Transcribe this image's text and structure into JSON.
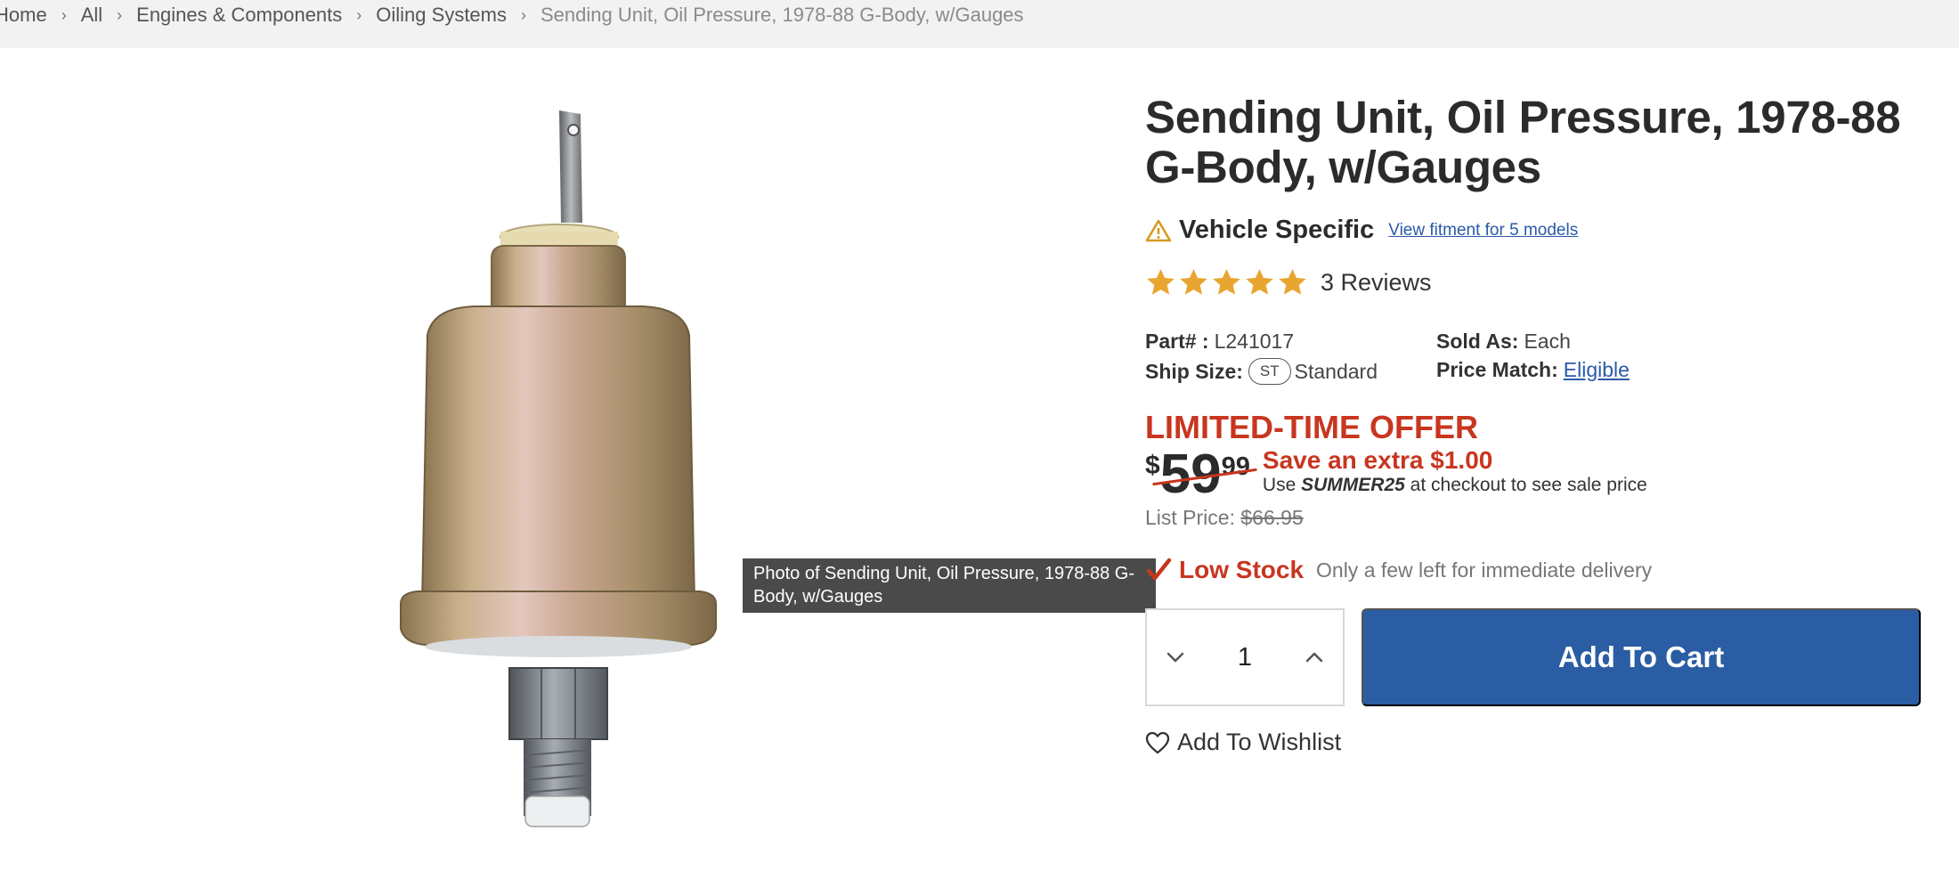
{
  "breadcrumb": {
    "items": [
      "Home",
      "All",
      "Engines & Components",
      "Oiling Systems"
    ],
    "current": "Sending Unit, Oil Pressure, 1978-88 G-Body, w/Gauges"
  },
  "image": {
    "tooltip": "Photo of Sending Unit, Oil Pressure, 1978-88 G-Body, w/Gauges"
  },
  "product": {
    "title": "Sending Unit, Oil Pressure, 1978-88 G-Body, w/Gauges",
    "vehicle_specific": "Vehicle Specific",
    "fitment_link": "View fitment for 5 models",
    "rating": 5,
    "reviews": "3 Reviews",
    "part_label": "Part# :",
    "part_number": "L241017",
    "sold_as_label": "Sold As:",
    "sold_as": "Each",
    "ship_size_label": "Ship Size:",
    "ship_size_badge": "ST",
    "ship_size": "Standard",
    "price_match_label": "Price Match:",
    "price_match": "Eligible"
  },
  "pricing": {
    "offer": "LIMITED-TIME OFFER",
    "currency": "$",
    "dollars": "59",
    "cents": "99",
    "save": "Save an extra $1.00",
    "promo_prefix": "Use",
    "promo_code": "SUMMER25",
    "promo_suffix": "at checkout to see sale price",
    "list_label": "List Price:",
    "list_price": "$66.95"
  },
  "stock": {
    "status": "Low Stock",
    "note": "Only a few left for immediate delivery"
  },
  "cart": {
    "quantity": "1",
    "add_label": "Add To Cart",
    "wishlist_label": "Add To Wishlist"
  },
  "colors": {
    "accent_blue": "#2a5da3",
    "offer_red": "#c8361f",
    "star_gold": "#e8a631"
  }
}
